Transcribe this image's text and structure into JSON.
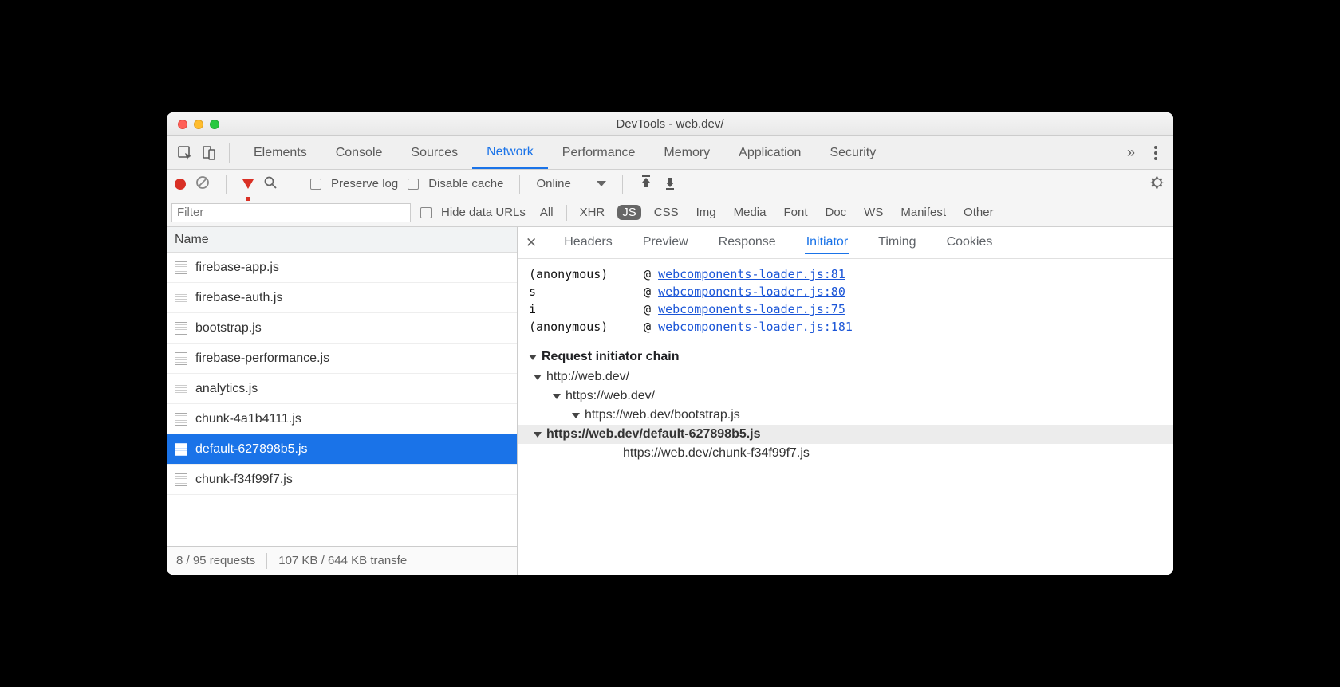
{
  "window": {
    "title": "DevTools - web.dev/"
  },
  "tabs": [
    "Elements",
    "Console",
    "Sources",
    "Network",
    "Performance",
    "Memory",
    "Application",
    "Security"
  ],
  "activeTab": "Network",
  "netToolbar": {
    "preserve": "Preserve log",
    "disable": "Disable cache",
    "throttle": "Online"
  },
  "filterRow": {
    "placeholder": "Filter",
    "hideData": "Hide data URLs",
    "types": [
      "All",
      "XHR",
      "JS",
      "CSS",
      "Img",
      "Media",
      "Font",
      "Doc",
      "WS",
      "Manifest",
      "Other"
    ],
    "activeType": "JS"
  },
  "leftHead": "Name",
  "requests": [
    "firebase-app.js",
    "firebase-auth.js",
    "bootstrap.js",
    "firebase-performance.js",
    "analytics.js",
    "chunk-4a1b4111.js",
    "default-627898b5.js",
    "chunk-f34f99f7.js"
  ],
  "selectedIndex": 6,
  "leftFoot": {
    "reqs": "8 / 95 requests",
    "transfer": "107 KB / 644 KB transfe"
  },
  "detailTabs": [
    "Headers",
    "Preview",
    "Response",
    "Initiator",
    "Timing",
    "Cookies"
  ],
  "activeDetailTab": "Initiator",
  "callStack": [
    {
      "fn": "(anonymous)",
      "src": "webcomponents-loader.js:81"
    },
    {
      "fn": "s",
      "src": "webcomponents-loader.js:80"
    },
    {
      "fn": "i",
      "src": "webcomponents-loader.js:75"
    },
    {
      "fn": "(anonymous)",
      "src": "webcomponents-loader.js:181"
    }
  ],
  "chainTitle": "Request initiator chain",
  "chain": [
    {
      "indent": 0,
      "text": "http://web.dev/",
      "tri": true
    },
    {
      "indent": 1,
      "text": "https://web.dev/",
      "tri": true
    },
    {
      "indent": 2,
      "text": "https://web.dev/bootstrap.js",
      "tri": true
    },
    {
      "indent": 3,
      "text": "https://web.dev/default-627898b5.js",
      "tri": true,
      "current": true
    },
    {
      "indent": 4,
      "text": "https://web.dev/chunk-f34f99f7.js",
      "tri": false
    }
  ]
}
